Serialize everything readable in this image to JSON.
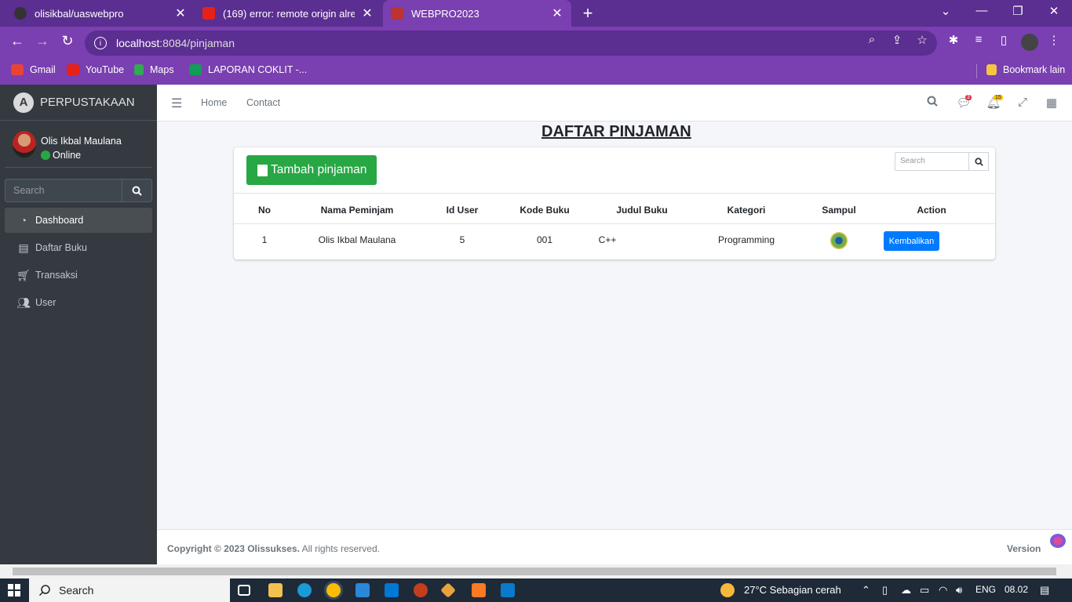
{
  "browser": {
    "tabs": [
      {
        "title": "olisikbal/uaswebpro",
        "icon": "github-icon"
      },
      {
        "title": "(169) error: remote origin already",
        "icon": "youtube-icon"
      },
      {
        "title": "WEBPRO2023",
        "icon": "site-icon"
      }
    ],
    "url_host": "localhost",
    "url_path": ":8084/pinjaman",
    "bookmarks": [
      "Gmail",
      "YouTube",
      "Maps",
      "LAPORAN COKLIT -...",
      "Bookmark lain"
    ]
  },
  "sidebar": {
    "brand": "PERPUSTAKAAN",
    "user_name": "Olis Ikbal Maulana",
    "user_status": "Online",
    "search_placeholder": "Search",
    "items": [
      {
        "label": "Dashboard",
        "icon": "dashboard-icon"
      },
      {
        "label": "Daftar Buku",
        "icon": "book-icon"
      },
      {
        "label": "Transaksi",
        "icon": "cart-icon"
      },
      {
        "label": "User",
        "icon": "users-icon"
      }
    ]
  },
  "topnav": {
    "links": [
      "Home",
      "Contact"
    ],
    "messages_badge": "3",
    "notifications_badge": "15"
  },
  "main": {
    "title": "DAFTAR PINJAMAN",
    "add_button": "Tambah pinjaman",
    "search_placeholder": "Search",
    "columns": [
      "No",
      "Nama Peminjam",
      "Id User",
      "Kode Buku",
      "Judul Buku",
      "Kategori",
      "Sampul",
      "Action"
    ],
    "rows": [
      {
        "no": "1",
        "nama": "Olis Ikbal Maulana",
        "id_user": "5",
        "kode_buku": "001",
        "judul_buku": "C++",
        "kategori": "Programming",
        "action": "Kembalikan"
      }
    ]
  },
  "footer": {
    "copyright_bold": "Copyright © 2023 Olissukses.",
    "copyright_rest": "All rights reserved.",
    "version": "Version"
  },
  "taskbar": {
    "search": "Search",
    "weather": "27°C  Sebagian cerah",
    "lang": "ENG",
    "time": "08.02"
  },
  "colors": {
    "sidebar": "#343a40",
    "primary_btn": "#007bff",
    "success_btn": "#28a745",
    "browser": "#7a3fb0"
  }
}
